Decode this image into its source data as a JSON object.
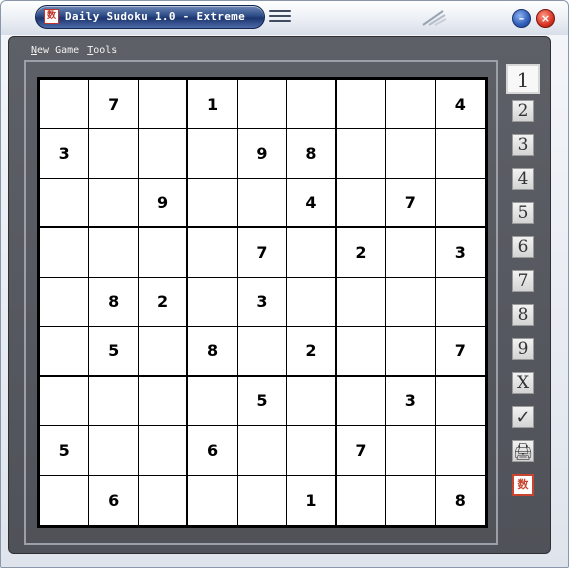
{
  "window": {
    "title": "Daily Sudoku 1.0 - Extreme",
    "app_icon_glyph": "数",
    "minimize_glyph": "–",
    "close_glyph": "×"
  },
  "menu": {
    "items": [
      {
        "first": "N",
        "rest": "ew Game"
      },
      {
        "first": "T",
        "rest": "ools"
      }
    ]
  },
  "board": {
    "rows": [
      [
        "",
        "7",
        "",
        "1",
        "",
        "",
        "",
        "",
        "4"
      ],
      [
        "3",
        "",
        "",
        "",
        "9",
        "8",
        "",
        "",
        ""
      ],
      [
        "",
        "",
        "9",
        "",
        "",
        "4",
        "",
        "7",
        ""
      ],
      [
        "",
        "",
        "",
        "",
        "7",
        "",
        "2",
        "",
        "3"
      ],
      [
        "",
        "8",
        "2",
        "",
        "3",
        "",
        "",
        "",
        ""
      ],
      [
        "",
        "5",
        "",
        "8",
        "",
        "2",
        "",
        "",
        "7"
      ],
      [
        "",
        "",
        "",
        "",
        "5",
        "",
        "",
        "3",
        ""
      ],
      [
        "5",
        "",
        "",
        "6",
        "",
        "",
        "7",
        "",
        ""
      ],
      [
        "",
        "6",
        "",
        "",
        "",
        "1",
        "",
        "",
        "8"
      ]
    ]
  },
  "palette": {
    "buttons": [
      {
        "label": "1",
        "name": "palette-number-1"
      },
      {
        "label": "2",
        "name": "palette-number-2"
      },
      {
        "label": "3",
        "name": "palette-number-3"
      },
      {
        "label": "4",
        "name": "palette-number-4"
      },
      {
        "label": "5",
        "name": "palette-number-5"
      },
      {
        "label": "6",
        "name": "palette-number-6"
      },
      {
        "label": "7",
        "name": "palette-number-7"
      },
      {
        "label": "8",
        "name": "palette-number-8"
      },
      {
        "label": "9",
        "name": "palette-number-9"
      },
      {
        "label": "X",
        "name": "clear-cell-button"
      },
      {
        "label": "✓",
        "name": "check-button"
      },
      {
        "label": "🖨",
        "name": "print-button"
      },
      {
        "label": "数",
        "name": "app-logo-button"
      }
    ]
  },
  "colors": {
    "panel": "#54575d",
    "title_pill": "#2c4b86",
    "close": "#d63423",
    "minimize": "#2f5db8"
  }
}
